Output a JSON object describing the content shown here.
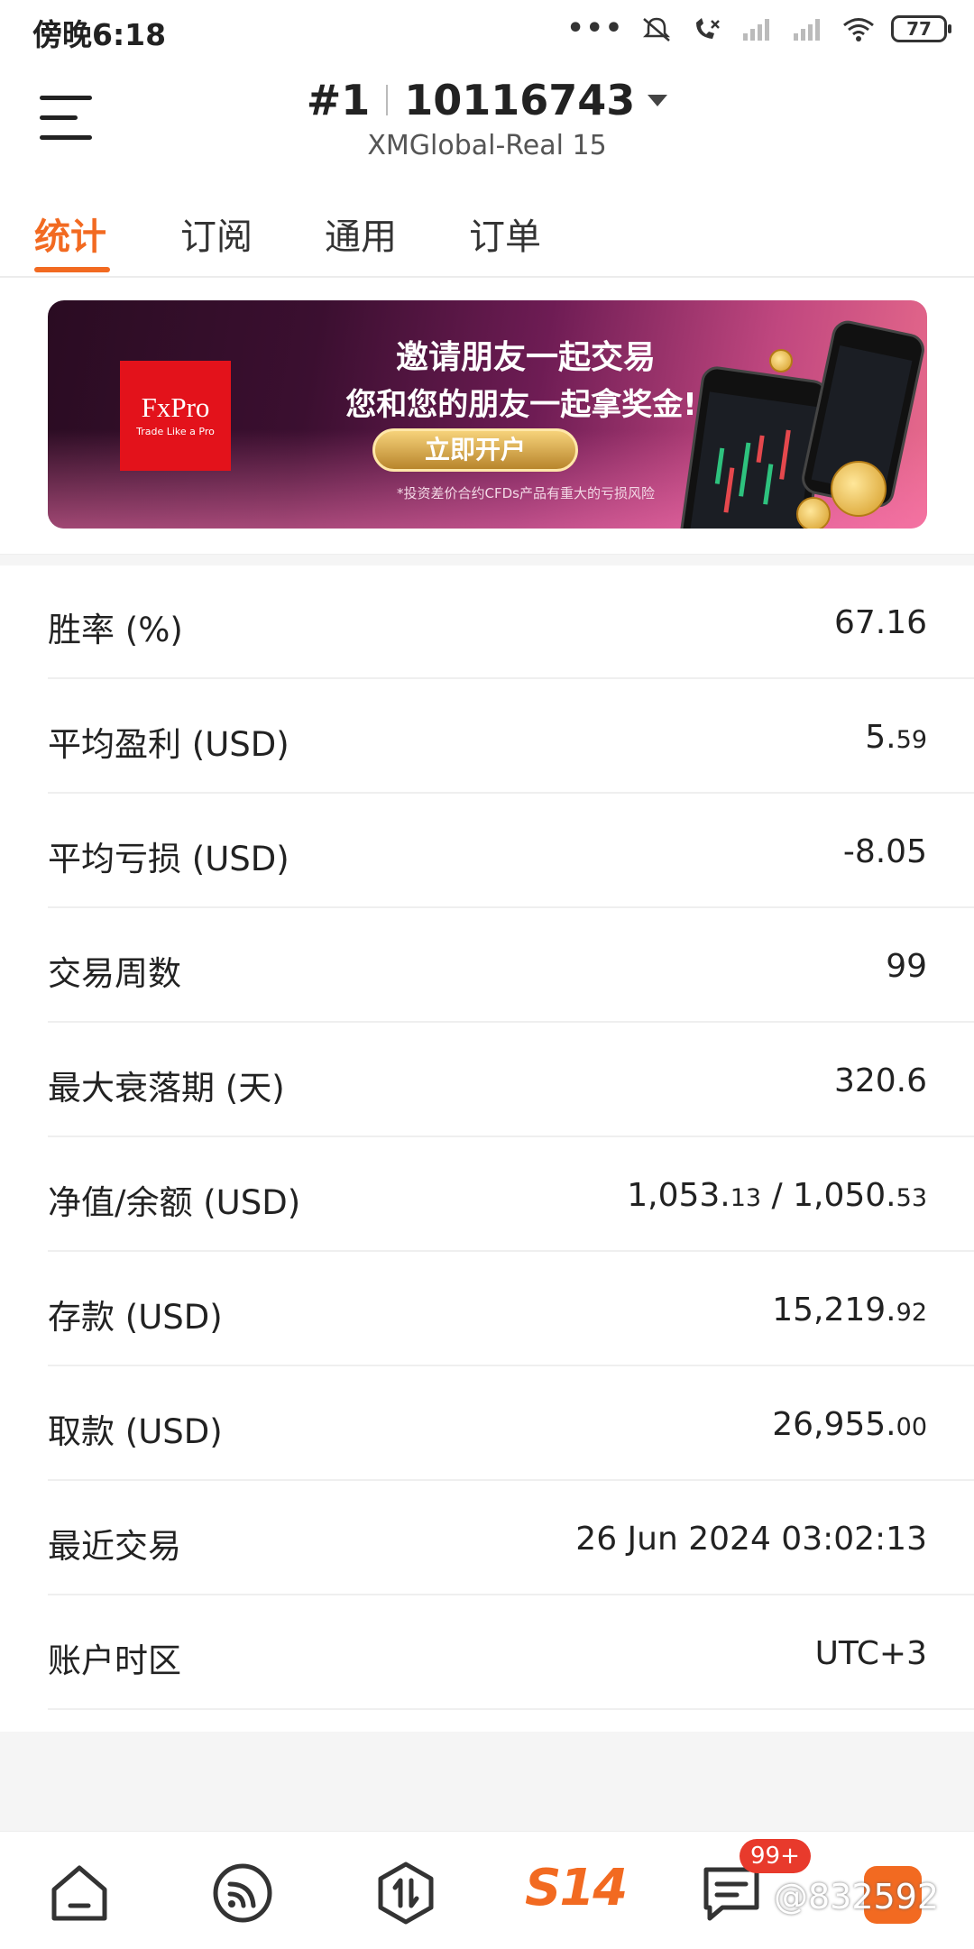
{
  "status_bar": {
    "time": "傍晚6:18",
    "dots": "•••",
    "battery": "77"
  },
  "header": {
    "rank": "#1",
    "account": "10116743",
    "server": "XMGlobal-Real 15"
  },
  "tabs": [
    {
      "label": "统计",
      "active": true
    },
    {
      "label": "订阅",
      "active": false
    },
    {
      "label": "通用",
      "active": false
    },
    {
      "label": "订单",
      "active": false
    }
  ],
  "banner": {
    "logo_name": "FxPro",
    "logo_slogan": "Trade Like a Pro",
    "line1": "邀请朋友一起交易",
    "line2": "您和您的朋友一起拿奖金!",
    "cta": "立即开户",
    "disclaimer": "*投资差价合约CFDs产品有重大的亏损风险"
  },
  "stats": [
    {
      "label": "胜率 (%)",
      "value": "67.16",
      "dec": ""
    },
    {
      "label": "平均盈利 (USD)",
      "value": "5.",
      "dec": "59"
    },
    {
      "label": "平均亏损 (USD)",
      "value": "-8.05",
      "dec": ""
    },
    {
      "label": "交易周数",
      "value": "99",
      "dec": ""
    },
    {
      "label": "最大衰落期 (天)",
      "value": "320.6",
      "dec": ""
    },
    {
      "label": "净值/余额 (USD)",
      "value": "1,053.",
      "dec": "13",
      "value2": " / 1,050.",
      "dec2": "53"
    },
    {
      "label": "存款 (USD)",
      "value": "15,219.",
      "dec": "92"
    },
    {
      "label": "取款 (USD)",
      "value": "26,955.",
      "dec": "00"
    },
    {
      "label": "最近交易",
      "value": "26 Jun 2024 03:02:13",
      "dec": ""
    },
    {
      "label": "账户时区",
      "value": "UTC+3",
      "dec": ""
    }
  ],
  "bottom_nav": {
    "items": [
      "home-icon",
      "feed-icon",
      "trade-icon",
      "s14-logo",
      "messages-icon",
      "profile-icon"
    ],
    "s14_label": "S14",
    "badge": "99+",
    "watermark": "@832592"
  },
  "colors": {
    "accent": "#f26a21",
    "badge": "#e83a2c",
    "logo_red": "#e3121b"
  }
}
